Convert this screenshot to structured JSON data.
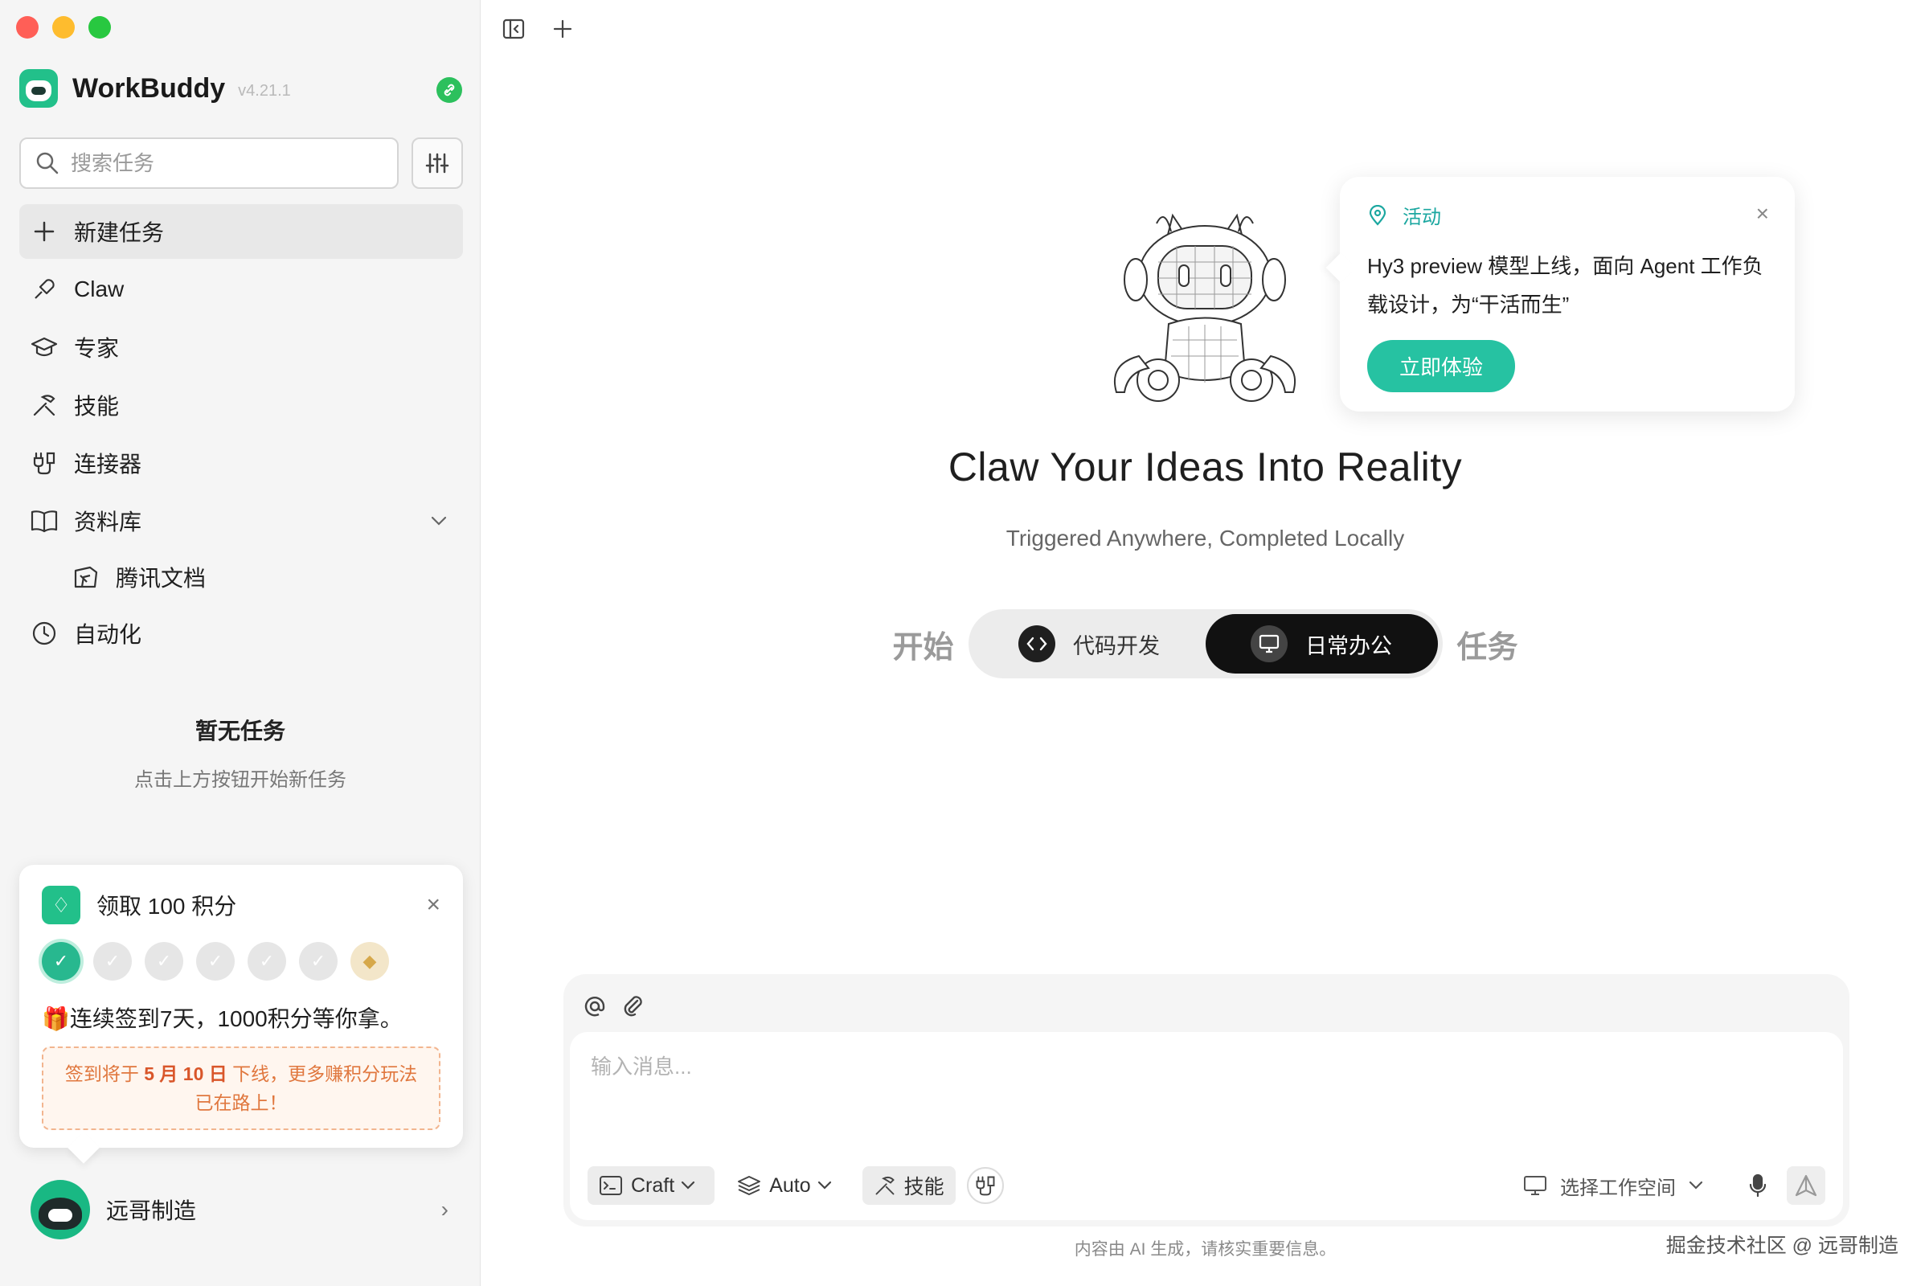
{
  "sidebar": {
    "brand": {
      "name": "WorkBuddy",
      "version": "v4.21.1"
    },
    "search": {
      "placeholder": "搜索任务"
    },
    "nav": [
      {
        "label": "新建任务",
        "icon": "plus-icon"
      },
      {
        "label": "Claw",
        "icon": "claw-icon"
      },
      {
        "label": "专家",
        "icon": "graduation-cap-icon"
      },
      {
        "label": "技能",
        "icon": "tools-icon"
      },
      {
        "label": "连接器",
        "icon": "connector-icon"
      },
      {
        "label": "资料库",
        "icon": "book-icon"
      },
      {
        "label": "腾讯文档",
        "icon": "tencent-docs-icon"
      },
      {
        "label": "自动化",
        "icon": "clock-icon"
      }
    ],
    "empty_state": {
      "title": "暂无任务",
      "subtitle": "点击上方按钮开始新任务"
    },
    "checkin": {
      "title": "领取 100 积分",
      "days_completed": 1,
      "days_total": 7,
      "message": "连续签到7天，1000积分等你拿。",
      "note_prefix": "签到将于 ",
      "note_date": "5 月 10 日",
      "note_suffix": " 下线，更多赚积分玩法已在路上！",
      "gift_emoji": "🎁"
    },
    "user": {
      "name": "远哥制造"
    }
  },
  "main": {
    "promo": {
      "tag": "活动",
      "body": "Hy3 preview 模型上线，面向 Agent 工作负载设计，为“干活而生”",
      "button": "立即体验"
    },
    "headline": "Claw Your Ideas Into Reality",
    "subline": "Triggered Anywhere, Completed Locally",
    "mode": {
      "left": "开始",
      "right": "任务",
      "options": [
        "代码开发",
        "日常办公"
      ],
      "selected": "日常办公"
    },
    "composer": {
      "placeholder": "输入消息...",
      "craft_label": "Craft",
      "auto_label": "Auto",
      "skills_label": "技能",
      "workspace_label": "选择工作空间"
    },
    "disclaimer": "内容由 AI 生成，请核实重要信息。",
    "watermark": "掘金技术社区 @ 远哥制造"
  },
  "colors": {
    "accent": "#26c2a2",
    "brand_green": "#22c08a",
    "note_orange": "#e0773e"
  }
}
